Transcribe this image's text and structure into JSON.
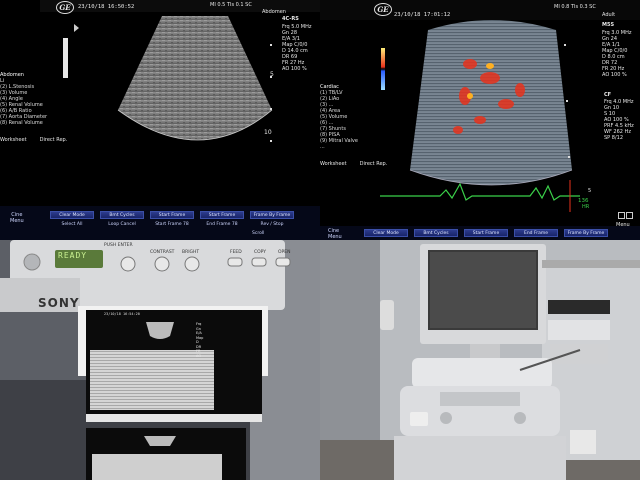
{
  "panel_tl": {
    "date_time": "23/10/18 16:50:52",
    "mi_tis": "MI 0.5   TIs 0.1 SC",
    "preset": "Abdomen",
    "probe": "4C-RS",
    "params": [
      [
        "Frq",
        "5.0 MHz"
      ],
      [
        "Gn",
        "28"
      ],
      [
        "E/A",
        "3/1"
      ],
      [
        "Map",
        "C/0/0"
      ],
      [
        "D",
        "14.0 cm"
      ],
      [
        "DR",
        "69"
      ],
      [
        "FR",
        "27 Hz"
      ],
      [
        "AO",
        "100 %"
      ]
    ],
    "depth_labels": [
      "5",
      "10"
    ],
    "left_menu_header": "Abdomen",
    "left_menu_status": "",
    "left_menu": [
      "Li",
      "(2) L.Stenosis",
      "(3) Volume",
      "(4) Angle",
      "(5) Renal Volume",
      "(6) A/B Ratio",
      "(7) Aorta Diameter",
      "(8) Renal Volume"
    ],
    "worksheet": [
      "Worksheet",
      "Direct Rep."
    ],
    "bottom_buttons": [
      "Clear Mode",
      "Bmt Cycles",
      "Start Frame",
      "Start Frame",
      "Frame By Frame"
    ],
    "bottom_sub": [
      "Select All",
      "Loop Cancel",
      "Start Frame 78",
      "End Frame 78",
      "Rev / Stop"
    ],
    "bottom_left": "Cine\nMenu",
    "scroll_label": "Scroll"
  },
  "panel_tr": {
    "date_time": "23/10/18 17:01:12",
    "mi_tis": "MI 0.8   TIs 0.3 SC",
    "preset": "Adult",
    "probe": "M5S",
    "params": [
      [
        "Frq",
        "3.0 MHz"
      ],
      [
        "Gn",
        "24"
      ],
      [
        "E/A",
        "1/1"
      ],
      [
        "Map",
        "C/0/0"
      ],
      [
        "D",
        "8.0 cm"
      ],
      [
        "DR",
        "72"
      ],
      [
        "FR",
        "20 Hz"
      ],
      [
        "AO",
        "100 %"
      ]
    ],
    "cf_header": "CF",
    "cf_params": [
      [
        "Frq",
        "4.0 MHz"
      ],
      [
        "Gn",
        "10"
      ],
      [
        "S",
        "10"
      ],
      [
        "AO",
        "100 %"
      ],
      [
        "PRF",
        "4.5 kHz"
      ],
      [
        "WF",
        "262 Hz"
      ],
      [
        "SP",
        "8/12"
      ]
    ],
    "depth_label": "5",
    "left_menu_header": "Cardiac",
    "left_menu_status": "",
    "left_menu": [
      "(1) TB/LV",
      "(2) LiAo",
      "(3) ...",
      "(4) Area",
      "(5) Volume",
      "(6) ...",
      "(7) Shunts",
      "(8) PISA",
      "(9) Mitral Valve",
      "..."
    ],
    "worksheet": [
      "Worksheet",
      "Direct Rep."
    ],
    "hr_value": "136",
    "hr_label": "HR",
    "bottom_buttons": [
      "Clear Mode",
      "Bmt Cycles",
      "Start Frame",
      "End Frame",
      "Frame By Frame"
    ],
    "bottom_left": "Cine\nMenu",
    "menu_label": "Menu"
  },
  "panel_bl": {
    "lcd_text": "READY",
    "labels": [
      "PUSH ENTER",
      "CONTRAST",
      "BRIGHT",
      "FEED",
      "COPY",
      "OPEN"
    ],
    "brand": "SONY",
    "print_header": "23/10/18 16:54:20",
    "print_params": [
      "Frq",
      "Gn",
      "E/A",
      "Map",
      "D",
      "DR",
      "FR",
      "AO"
    ]
  },
  "panel_br": {
    "colors": {
      "machine": "#e6e7e9",
      "screen": "#3a3a3a"
    }
  },
  "colors": {
    "ui_blue": "#1e2a78",
    "doppler_red": "#e8321c",
    "ecg_green": "#3bd14a"
  }
}
